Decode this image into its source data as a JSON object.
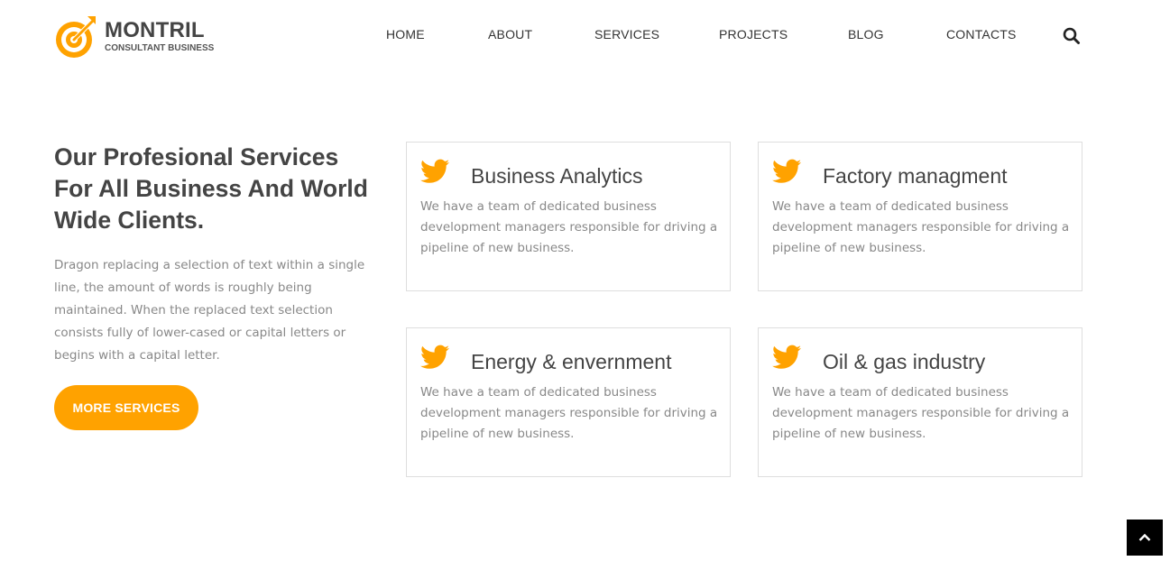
{
  "brand": {
    "name": "MONTRIL",
    "tagline": "CONSULTANT BUSINESS",
    "accent_color": "#ffa200",
    "logo_icon": "target-arrow-icon"
  },
  "nav": {
    "items": [
      {
        "label": "HOME"
      },
      {
        "label": "ABOUT"
      },
      {
        "label": "SERVICES"
      },
      {
        "label": "PROJECTS"
      },
      {
        "label": "BLOG"
      },
      {
        "label": "CONTACTS"
      }
    ],
    "search_icon": "search-icon"
  },
  "intro": {
    "heading": "Our Profesional Services For All Business And World Wide Clients.",
    "text": "Dragon replacing a selection of text within a single line, the amount of words is roughly being maintained. When the replaced text selection consists fully of lower-cased or capital letters or begins with a capital letter.",
    "button_label": "MORE SERVICES"
  },
  "services": [
    {
      "title": "Business Analytics",
      "text": "We have a team of dedicated business development managers responsible for driving a pipeline of new business.",
      "icon": "twitter-bird-icon"
    },
    {
      "title": "Factory managment",
      "text": "We have a team of dedicated business development managers responsible for driving a pipeline of new business.",
      "icon": "twitter-bird-icon"
    },
    {
      "title": "Energy & envernment",
      "text": "We have a team of dedicated business development managers responsible for driving a pipeline of new business.",
      "icon": "twitter-bird-icon"
    },
    {
      "title": "Oil & gas industry",
      "text": "We have a team of dedicated business development managers responsible for driving a pipeline of new business.",
      "icon": "twitter-bird-icon"
    }
  ],
  "back_to_top_icon": "chevron-up-icon"
}
